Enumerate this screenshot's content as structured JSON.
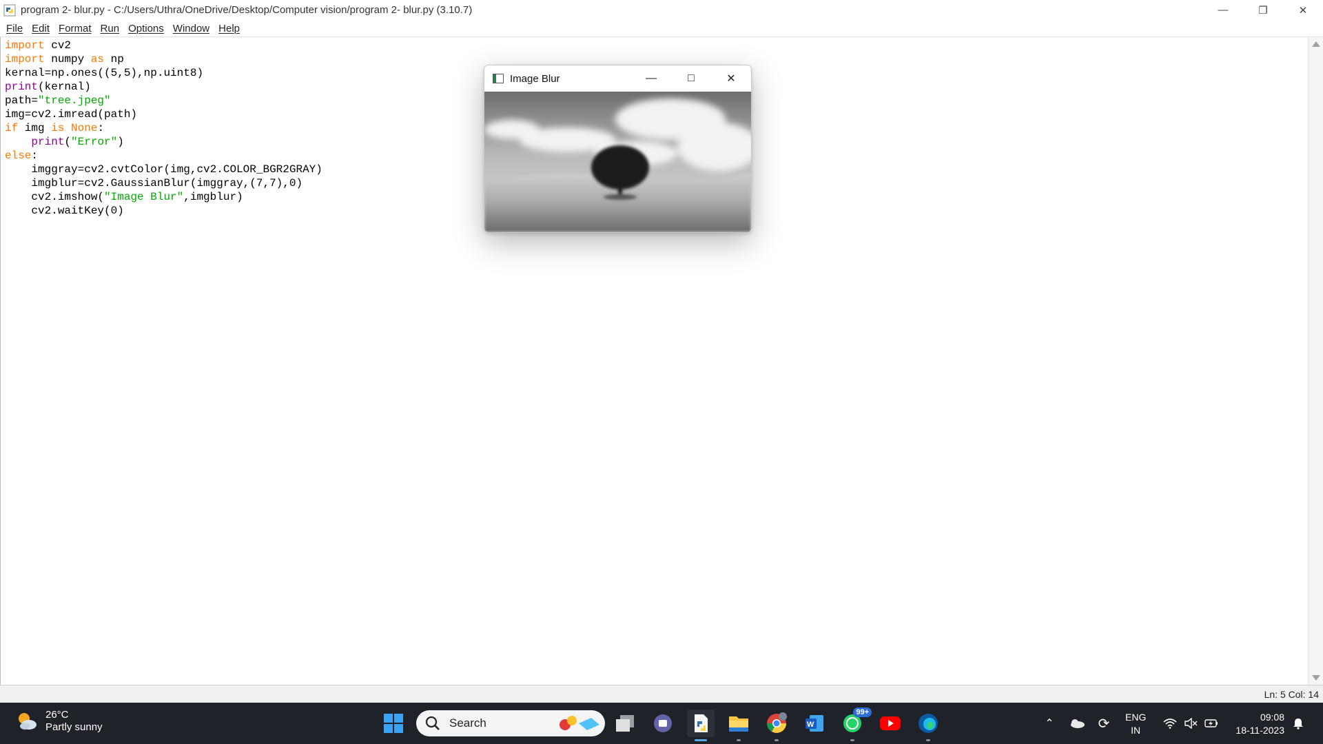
{
  "window": {
    "title": "program 2- blur.py - C:/Users/Uthra/OneDrive/Desktop/Computer vision/program 2- blur.py (3.10.7)",
    "controls": [
      "minimize",
      "restore",
      "close"
    ]
  },
  "menu": {
    "items": [
      "File",
      "Edit",
      "Format",
      "Run",
      "Options",
      "Window",
      "Help"
    ]
  },
  "editor": {
    "lines": [
      [
        {
          "t": "import",
          "c": "kw"
        },
        {
          "t": " cv2",
          "c": ""
        }
      ],
      [
        {
          "t": "import",
          "c": "kw"
        },
        {
          "t": " numpy ",
          "c": ""
        },
        {
          "t": "as",
          "c": "kw"
        },
        {
          "t": " np",
          "c": ""
        }
      ],
      [
        {
          "t": "kernal=np.ones((5,5),np.uint8)",
          "c": ""
        }
      ],
      [
        {
          "t": "print",
          "c": "bi"
        },
        {
          "t": "(kernal)",
          "c": ""
        }
      ],
      [
        {
          "t": "path=",
          "c": ""
        },
        {
          "t": "\"tree.jpeg\"",
          "c": "st"
        }
      ],
      [
        {
          "t": "img=cv2.imread(path)",
          "c": ""
        }
      ],
      [
        {
          "t": "if",
          "c": "kw"
        },
        {
          "t": " img ",
          "c": ""
        },
        {
          "t": "is",
          "c": "kw"
        },
        {
          "t": " ",
          "c": ""
        },
        {
          "t": "None",
          "c": "kw"
        },
        {
          "t": ":",
          "c": ""
        }
      ],
      [
        {
          "t": "    ",
          "c": ""
        },
        {
          "t": "print",
          "c": "bi"
        },
        {
          "t": "(",
          "c": ""
        },
        {
          "t": "\"Error\"",
          "c": "st"
        },
        {
          "t": ")",
          "c": ""
        }
      ],
      [
        {
          "t": "else",
          "c": "kw"
        },
        {
          "t": ":",
          "c": ""
        }
      ],
      [
        {
          "t": "    imggray=cv2.cvtColor(img,cv2.COLOR_BGR2GRAY)",
          "c": ""
        }
      ],
      [
        {
          "t": "    imgblur=cv2.GaussianBlur(imggray,(7,7),0)",
          "c": ""
        }
      ],
      [
        {
          "t": "    cv2.imshow(",
          "c": ""
        },
        {
          "t": "\"Image Blur\"",
          "c": "st"
        },
        {
          "t": ",imgblur)",
          "c": ""
        }
      ],
      [
        {
          "t": "    cv2.waitKey(0)",
          "c": ""
        }
      ]
    ]
  },
  "status": {
    "position": "Ln: 5   Col: 14"
  },
  "image_window": {
    "title": "Image Blur"
  },
  "taskbar": {
    "weather": {
      "temp": "26°C",
      "desc": "Partly sunny"
    },
    "search_label": "Search",
    "apps": [
      "start",
      "task-view",
      "teams",
      "idle",
      "file-explorer",
      "chrome",
      "word",
      "whatsapp",
      "youtube",
      "edge"
    ],
    "whatsapp_badge": "99+",
    "language": {
      "line1": "ENG",
      "line2": "IN"
    },
    "clock": {
      "time": "09:08",
      "date": "18-11-2023"
    }
  }
}
